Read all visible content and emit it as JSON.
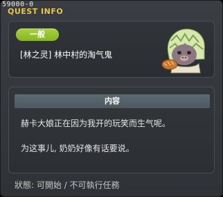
{
  "header": {
    "id": "59000-0",
    "title": "QUEST INFO"
  },
  "quest": {
    "category": "一般",
    "name": "[林之灵] 林中村的淘气鬼",
    "npc_icon": "npc-portrait-icon"
  },
  "content": {
    "header": "内容",
    "lines": [
      "赫卡大娘正在因为我开的玩笑而生气呢。",
      "为这事儿, 奶奶好像有话要说。"
    ]
  },
  "status": {
    "text": "狀態:  可開始  / 不可執行任務"
  },
  "colors": {
    "title": "#e8c84a",
    "pill": "#96c42f",
    "background": "#33363a"
  }
}
